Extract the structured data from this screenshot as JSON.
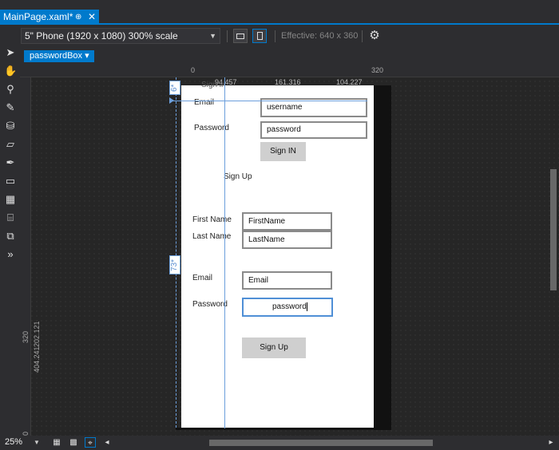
{
  "tab": {
    "title": "MainPage.xaml*",
    "pin": "⊕",
    "close": "✕"
  },
  "toolbar": {
    "device": "5\" Phone (1920 x 1080) 300% scale",
    "effective": "Effective: 640 x 360"
  },
  "breadcrumb": {
    "label": "passwordBox ▾"
  },
  "rulers": {
    "top": [
      "0",
      "320"
    ],
    "left": [
      "320",
      "404.241",
      "202.121",
      "0"
    ]
  },
  "measures": {
    "top_values": [
      "94.457",
      "161.316",
      "104.227"
    ],
    "margin_top": "6*",
    "margin_left": "73*"
  },
  "form": {
    "login": {
      "partial_label": "Sign in",
      "email_label": "Email",
      "username_value": "username",
      "password_label": "Password",
      "password_value": "password",
      "signin_button": "Sign IN"
    },
    "signup": {
      "title": "Sign Up",
      "firstname_label": "First Name",
      "firstname_value": "FirstName",
      "lastname_label": "Last Name",
      "lastname_value": "LastName",
      "email_label": "Email",
      "email_value": "Email",
      "password_label": "Password",
      "password_value": "password",
      "signup_button": "Sign Up"
    }
  },
  "statusbar": {
    "zoom": "25%"
  }
}
